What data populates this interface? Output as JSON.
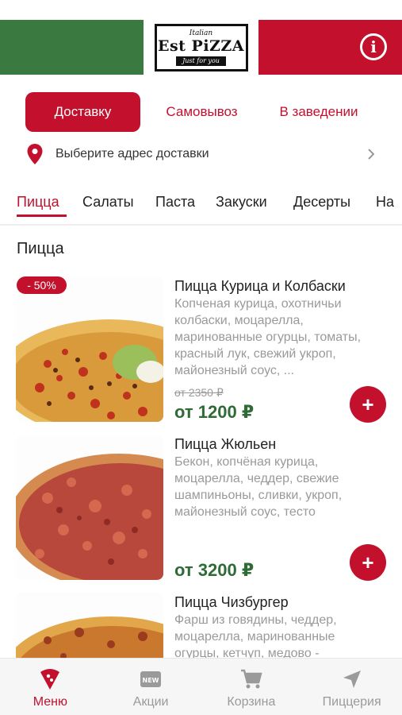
{
  "header": {
    "logo_script": "Italian",
    "logo_main": "Est PiZZA",
    "logo_sub": "Just for you",
    "info_icon": "info-icon"
  },
  "modes": {
    "delivery": "Доставку",
    "pickup": "Самовывоз",
    "dine_in": "В заведении"
  },
  "address": {
    "label": "Выберите адрес доставки"
  },
  "categories": [
    "Пицца",
    "Салаты",
    "Паста",
    "Закуски",
    "Десерты",
    "На"
  ],
  "section_title": "Пицца",
  "products": [
    {
      "badge": "- 50%",
      "title": "Пицца Курица и Колбаски",
      "description": "Копченая курица, охотничьи колбаски, моцарелла, маринованные огурцы, томаты, красный лук, свежий укроп, майонезный соус, ...",
      "old_price": "от 2350 ₽",
      "price": "от 1200 ₽"
    },
    {
      "title": "Пицца Жюльен",
      "description": "Бекон, копчёная курица, моцарелла, чеддер, свежие шампиньоны, сливки, укроп, майонезный соус, тесто",
      "price": "от 3200 ₽"
    },
    {
      "title": "Пицца Чизбургер",
      "description": "Фарш из говядины, чеддер, моцарелла, маринованные огурцы, кетчуп, медово -"
    }
  ],
  "nav": {
    "menu": "Меню",
    "promo": "Акции",
    "cart": "Корзина",
    "pizzeria": "Пиццерия"
  },
  "colors": {
    "brand_red": "#c3102d",
    "brand_green": "#3a7a40",
    "price_green": "#2f6b36"
  }
}
